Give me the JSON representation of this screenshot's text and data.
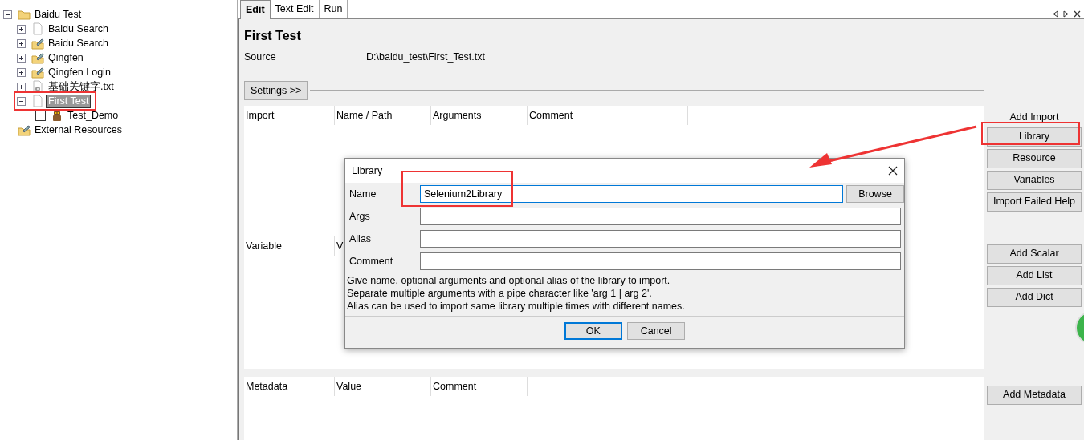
{
  "tree": [
    {
      "label": "Baidu Test",
      "kind": "folder",
      "expanded": true,
      "selected": false,
      "children": [
        {
          "label": "Baidu Search",
          "kind": "file",
          "expanded": false,
          "selected": false
        },
        {
          "label": "Baidu Search",
          "kind": "resource",
          "expanded": false,
          "selected": false
        },
        {
          "label": "Qingfen",
          "kind": "resource",
          "expanded": false,
          "selected": false
        },
        {
          "label": "Qingfen Login",
          "kind": "resource",
          "expanded": false,
          "selected": false
        },
        {
          "label": "基础关键字.txt",
          "kind": "keyword-file",
          "expanded": false,
          "selected": false
        },
        {
          "label": "First Test",
          "kind": "file",
          "expanded": true,
          "selected": true,
          "children": [
            {
              "label": "Test_Demo",
              "kind": "test",
              "checked": false,
              "selected": false
            }
          ]
        }
      ]
    },
    {
      "label": "External Resources",
      "kind": "resource",
      "selected": false
    }
  ],
  "tabs": [
    {
      "label": "Edit",
      "selected": true
    },
    {
      "label": "Text Edit",
      "selected": false
    },
    {
      "label": "Run",
      "selected": false
    }
  ],
  "suite": {
    "title": "First Test",
    "source_label": "Source",
    "source": "D:\\baidu_test\\First_Test.txt",
    "settings_button": "Settings >>"
  },
  "import_table": {
    "columns": [
      "Import",
      "Name / Path",
      "Arguments",
      "Comment"
    ]
  },
  "import_panel": {
    "heading": "Add Import",
    "buttons": [
      "Library",
      "Resource",
      "Variables",
      "Import Failed Help"
    ]
  },
  "variable_table": {
    "columns": [
      "Variable",
      "V"
    ]
  },
  "variable_buttons": [
    "Add Scalar",
    "Add List",
    "Add Dict"
  ],
  "metadata_table": {
    "columns": [
      "Metadata",
      "Value",
      "Comment"
    ]
  },
  "metadata_buttons": [
    "Add Metadata"
  ],
  "dialog": {
    "title": "Library",
    "fields": [
      {
        "label": "Name",
        "value": "Selenium2Library",
        "focused": true
      },
      {
        "label": "Args",
        "focused": false
      },
      {
        "label": "Alias",
        "focused": false
      },
      {
        "label": "Comment",
        "focused": false
      }
    ],
    "browse_button": "Browse",
    "help_lines": [
      "Give name, optional arguments and optional alias of the library to import.",
      "Separate multiple arguments with a pipe character like 'arg 1 | arg 2'.",
      "Alias can be used to import same library multiple times with different names."
    ],
    "buttons": [
      {
        "label": "OK",
        "default": true
      },
      {
        "label": "Cancel",
        "default": false
      }
    ]
  }
}
